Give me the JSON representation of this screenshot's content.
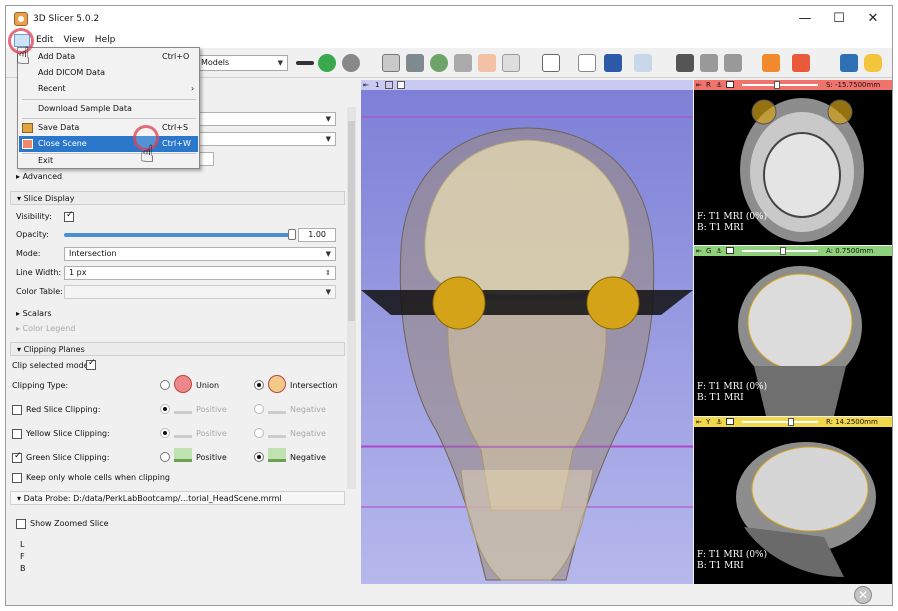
{
  "window": {
    "title": "3D Slicer 5.0.2",
    "minimize": "—",
    "maximize": "☐",
    "close": "✕"
  },
  "menubar": {
    "file": "File",
    "edit": "Edit",
    "view": "View",
    "help": "Help"
  },
  "toolbar": {
    "module_combo": "Models",
    "back_icon": "arrow-left-icon",
    "forward_icon": "arrow-right-icon"
  },
  "file_menu": {
    "add_data": "Add Data",
    "add_data_shortcut": "Ctrl+O",
    "add_dicom": "Add DICOM Data",
    "recent": "Recent",
    "recent_arrow": "›",
    "download_sample": "Download Sample Data",
    "save_data": "Save Data",
    "save_data_shortcut": "Ctrl+S",
    "close_scene": "Close Scene",
    "close_scene_shortcut": "Ctrl+W",
    "exit": "Exit"
  },
  "panel": {
    "advanced": "Advanced",
    "slice_display": "Slice Display",
    "visibility": "Visibility:",
    "opacity": "Opacity:",
    "opacity_value": "1.00",
    "opacity_fraction": 1.0,
    "mode": "Mode:",
    "mode_value": "Intersection",
    "line_width": "Line Width:",
    "line_width_value": "1 px",
    "color_table": "Color Table:",
    "scalars": "Scalars",
    "color_legend": "Color Legend",
    "clipping_planes": "Clipping Planes",
    "clip_selected": "Clip selected model:",
    "clipping_type": "Clipping Type:",
    "union": "Union",
    "intersection": "Intersection",
    "red_clip": "Red Slice Clipping:",
    "yellow_clip": "Yellow Slice Clipping:",
    "green_clip": "Green Slice Clipping:",
    "positive": "Positive",
    "negative": "Negative",
    "keep_whole": "Keep only whole cells when clipping",
    "data_probe": "Data Probe: D:/data/PerkLabBootcamp/...torial_HeadScene.mrml",
    "show_zoomed": "Show Zoomed Slice",
    "probe_l": "L",
    "probe_f": "F",
    "probe_b": "B"
  },
  "view3d": {
    "label": "1"
  },
  "slices": [
    {
      "letter": "R",
      "color": "#f0736c",
      "offset": "S: -15.7500mm",
      "slider_fraction": 0.42,
      "f_text": "F: T1 MRI (0%)",
      "b_text": "B: T1 MRI"
    },
    {
      "letter": "G",
      "color": "#8fd07b",
      "offset": "A: 0.7500mm",
      "slider_fraction": 0.5,
      "f_text": "F: T1 MRI (0%)",
      "b_text": "B: T1 MRI"
    },
    {
      "letter": "Y",
      "color": "#f0d84a",
      "offset": "R: 14.2500mm",
      "slider_fraction": 0.6,
      "f_text": "F: T1 MRI (0%)",
      "b_text": "B: T1 MRI"
    }
  ]
}
